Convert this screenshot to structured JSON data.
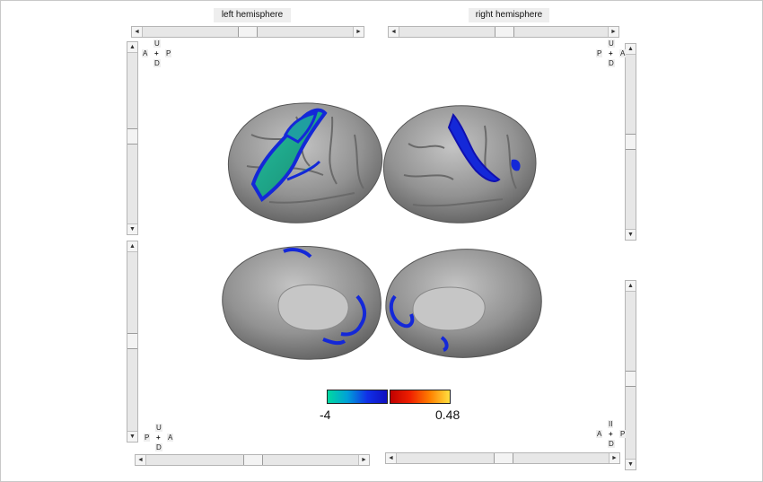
{
  "panels": {
    "left_title": "left hemisphere",
    "right_title": "right hemisphere"
  },
  "orientation": {
    "top_left": {
      "up": "U",
      "down": "D",
      "left": "A",
      "right": "P",
      "center": "+"
    },
    "top_right": {
      "up": "U",
      "down": "D",
      "left": "P",
      "right": "A",
      "center": "+"
    },
    "bottom_left": {
      "up": "U",
      "down": "D",
      "left": "P",
      "right": "A",
      "center": "+"
    },
    "bottom_right": {
      "up": "II",
      "down": "D",
      "left": "A",
      "right": "P",
      "center": "+"
    }
  },
  "scroll_arrows": {
    "left": "◄",
    "right": "►",
    "up": "▲",
    "down": "▼"
  },
  "colorbar": {
    "min_label": "-4",
    "max_label": "0.48",
    "negative_colors": [
      "#00d9a0",
      "#00a0d8",
      "#1030e8",
      "#1010c0"
    ],
    "positive_colors": [
      "#c00000",
      "#f02000",
      "#ff8000",
      "#ffe040"
    ]
  },
  "colors": {
    "cortex": "#8e8e8e",
    "cortex_light": "#b8b8b8",
    "activation_blue": "#1428d8",
    "activation_teal": "#1fb08a"
  }
}
